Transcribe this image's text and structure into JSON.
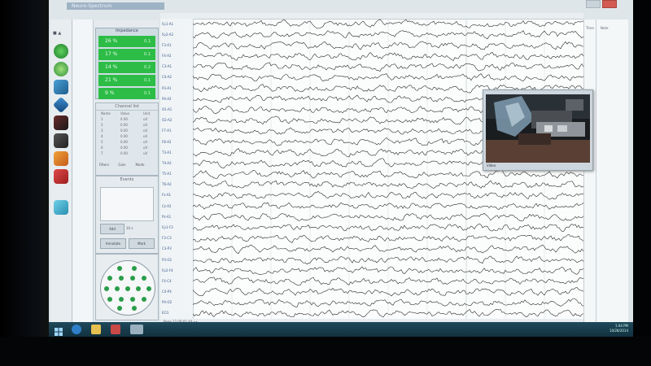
{
  "window": {
    "title": "Neuro-Spectrum",
    "minimize_label": "–",
    "close_label": "×"
  },
  "toolbar_strip": {
    "top_label": "■ ▲",
    "icons": [
      "play-icon",
      "refresh-icon",
      "tool-icon-3",
      "tool-icon-4",
      "tool-icon-5",
      "tool-icon-6",
      "tool-icon-7",
      "tool-icon-8",
      "tool-icon-9"
    ]
  },
  "impedance": {
    "title": "Impedance",
    "rows": [
      {
        "label": "26 %",
        "value": "0.1"
      },
      {
        "label": "17 %",
        "value": "0.1"
      },
      {
        "label": "14 %",
        "value": "0.2"
      },
      {
        "label": "21 %",
        "value": "0.1"
      },
      {
        "label": "9 %",
        "value": "0.1"
      }
    ]
  },
  "channels": {
    "title": "Channel list",
    "rows": [
      {
        "a": "Name",
        "b": "Value",
        "c": "Unit"
      },
      {
        "a": "1",
        "b": "0.00",
        "c": "uV"
      },
      {
        "a": "2",
        "b": "0.00",
        "c": "uV"
      },
      {
        "a": "3",
        "b": "0.00",
        "c": "uV"
      },
      {
        "a": "4",
        "b": "0.00",
        "c": "uV"
      },
      {
        "a": "5",
        "b": "0.00",
        "c": "uV"
      },
      {
        "a": "6",
        "b": "0.00",
        "c": "uV"
      },
      {
        "a": "7",
        "b": "0.00",
        "c": "uV"
      }
    ],
    "buttons": [
      "Filters",
      "Gain",
      "Mode"
    ]
  },
  "events": {
    "title": "Events",
    "add_button": "Add",
    "time_label": "10 s",
    "button_left": "Annotate",
    "button_right": "Mark"
  },
  "montage": {
    "title": "Montage"
  },
  "eeg": {
    "channel_labels": [
      "Fp1-A1",
      "Fp2-A2",
      "F3-A1",
      "F4-A2",
      "C3-A1",
      "C4-A2",
      "P3-A1",
      "P4-A2",
      "O1-A1",
      "O2-A2",
      "F7-A1",
      "F8-A2",
      "T3-A1",
      "T4-A2",
      "T5-A1",
      "T6-A2",
      "Fz-A1",
      "Cz-A2",
      "Pz-A1",
      "Fp1-F3",
      "F3-C3",
      "C3-P3",
      "P3-O1",
      "Fp2-F4",
      "F4-C4",
      "C4-P4",
      "P4-O2",
      "ECG"
    ],
    "bottom_text": "Page 12  00:01:44  ◂ ▸",
    "colors": {
      "trace": "#2a2a2a",
      "gridline": "#c9d3d8",
      "label": "#3c5b8c"
    }
  },
  "video": {
    "caption": "Video"
  },
  "right_panel": {
    "col1_header": "Time",
    "col2_header": "Note"
  },
  "taskbar": {
    "items": [
      "start-icon",
      "internet-explorer-icon",
      "file-explorer-icon",
      "media-icon",
      "eeg-app-icon"
    ],
    "clock_time": "1:44 PM",
    "clock_date": "10/28/2014"
  }
}
